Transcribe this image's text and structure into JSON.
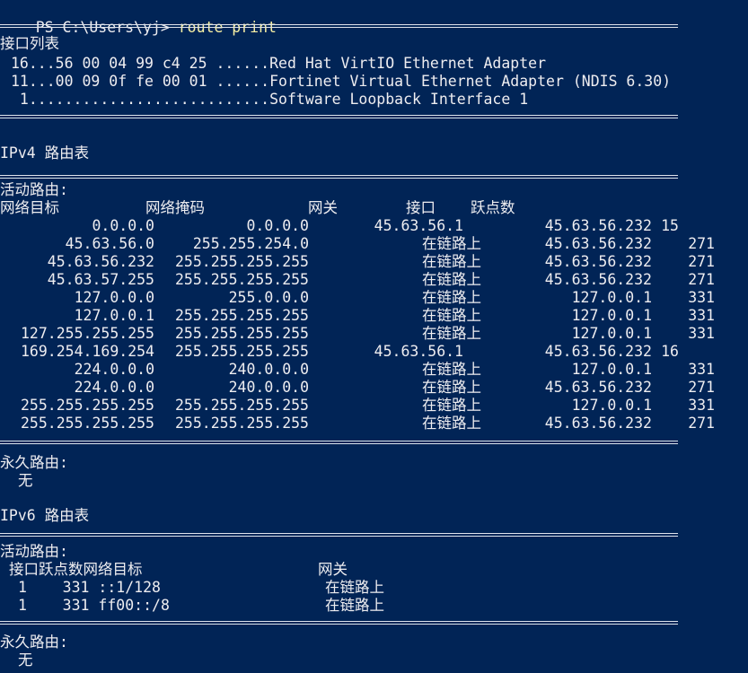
{
  "prompt": {
    "ps_prefix": "PS C:\\Users\\yj>",
    "command": "route print"
  },
  "interface_list": {
    "title": "接口列表",
    "entries": [
      "16...56 00 04 99 c4 25 ......Red Hat VirtIO Ethernet Adapter",
      "11...00 09 0f fe 00 01 ......Fortinet Virtual Ethernet Adapter (NDIS 6.30)",
      " 1...........................Software Loopback Interface 1"
    ]
  },
  "ipv4": {
    "title": "IPv4 路由表",
    "active_title": "活动路由:",
    "headers": {
      "destination": "网络目标",
      "netmask": "网络掩码",
      "gateway": "网关",
      "interface": "接口",
      "metric": "跃点数"
    },
    "rows": [
      {
        "dest": "0.0.0.0",
        "mask": "0.0.0.0",
        "gateway": "45.63.56.1",
        "iface": "45.63.56.232",
        "metric": "15"
      },
      {
        "dest": "45.63.56.0",
        "mask": "255.255.254.0",
        "gateway": "在链路上",
        "iface": "45.63.56.232",
        "metric": "271"
      },
      {
        "dest": "45.63.56.232",
        "mask": "255.255.255.255",
        "gateway": "在链路上",
        "iface": "45.63.56.232",
        "metric": "271"
      },
      {
        "dest": "45.63.57.255",
        "mask": "255.255.255.255",
        "gateway": "在链路上",
        "iface": "45.63.56.232",
        "metric": "271"
      },
      {
        "dest": "127.0.0.0",
        "mask": "255.0.0.0",
        "gateway": "在链路上",
        "iface": "127.0.0.1",
        "metric": "331"
      },
      {
        "dest": "127.0.0.1",
        "mask": "255.255.255.255",
        "gateway": "在链路上",
        "iface": "127.0.0.1",
        "metric": "331"
      },
      {
        "dest": "127.255.255.255",
        "mask": "255.255.255.255",
        "gateway": "在链路上",
        "iface": "127.0.0.1",
        "metric": "331"
      },
      {
        "dest": "169.254.169.254",
        "mask": "255.255.255.255",
        "gateway": "45.63.56.1",
        "iface": "45.63.56.232",
        "metric": "16"
      },
      {
        "dest": "224.0.0.0",
        "mask": "240.0.0.0",
        "gateway": "在链路上",
        "iface": "127.0.0.1",
        "metric": "331"
      },
      {
        "dest": "224.0.0.0",
        "mask": "240.0.0.0",
        "gateway": "在链路上",
        "iface": "45.63.56.232",
        "metric": "271"
      },
      {
        "dest": "255.255.255.255",
        "mask": "255.255.255.255",
        "gateway": "在链路上",
        "iface": "127.0.0.1",
        "metric": "331"
      },
      {
        "dest": "255.255.255.255",
        "mask": "255.255.255.255",
        "gateway": "在链路上",
        "iface": "45.63.56.232",
        "metric": "271"
      }
    ],
    "persistent_title": "永久路由:",
    "persistent_value": "无"
  },
  "ipv6": {
    "title": "IPv6 路由表",
    "active_title": "活动路由:",
    "header_left": "接口跃点数网络目标",
    "header_gateway": "网关",
    "rows": [
      {
        "left": "1    331 ::1/128",
        "gateway": "在链路上"
      },
      {
        "left": "1    331 ff00::/8",
        "gateway": "在链路上"
      }
    ],
    "persistent_title": "永久路由:",
    "persistent_value": "无"
  }
}
